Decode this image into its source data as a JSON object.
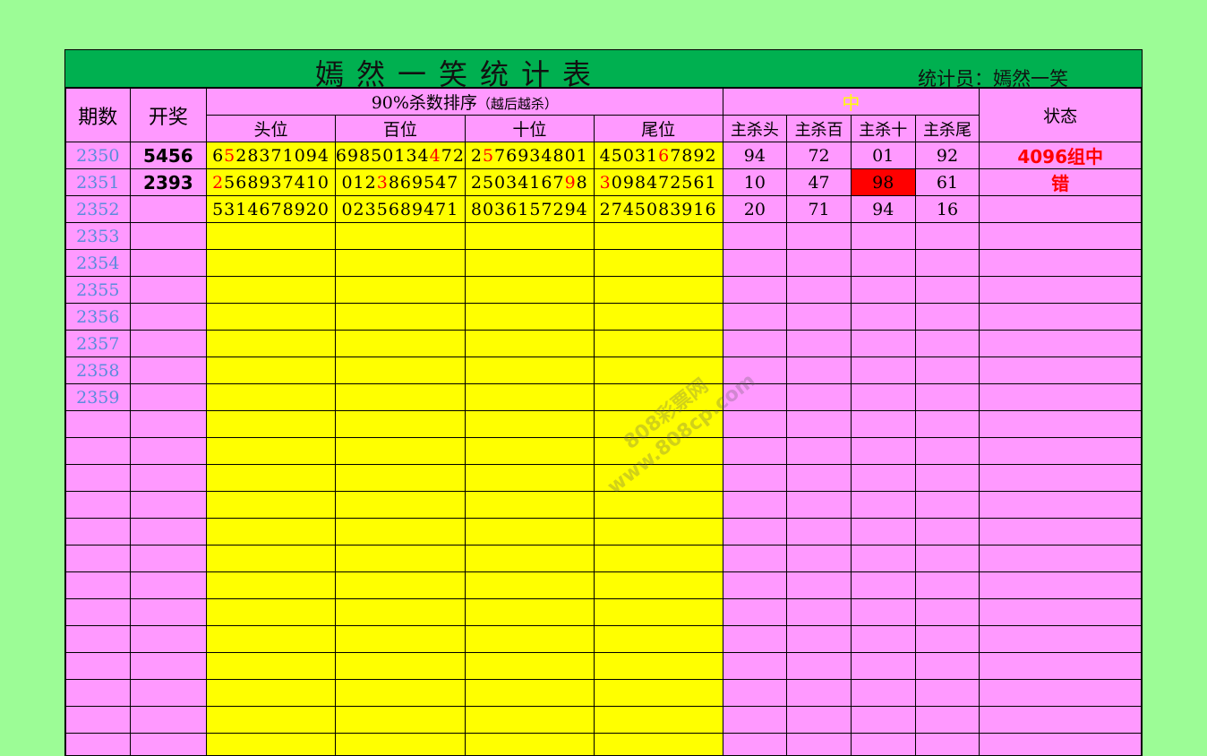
{
  "title": "嫣然一笑统计表",
  "recorder": "统计员：嫣然一笑",
  "headers": {
    "period": "期数",
    "draw": "开奖",
    "kill_group": "90%杀数排序",
    "kill_group_note": "（越后越杀）",
    "positions": [
      "头位",
      "百位",
      "十位",
      "尾位"
    ],
    "hit_group": "中",
    "main_kills": [
      "主杀头",
      "主杀百",
      "主杀十",
      "主杀尾"
    ],
    "status": "状态"
  },
  "rows": [
    {
      "period": "2350",
      "draw": "5456",
      "sequences": [
        [
          {
            "t": "6"
          },
          {
            "t": "5",
            "hl": true
          },
          {
            "t": "28371094"
          }
        ],
        [
          {
            "t": "69850134",
            "hl": false
          },
          {
            "t": "4",
            "hl": true
          },
          {
            "t": "72"
          }
        ],
        [
          {
            "t": "2"
          },
          {
            "t": "5",
            "hl": true
          },
          {
            "t": "76934801"
          }
        ],
        [
          {
            "t": "45031"
          },
          {
            "t": "6",
            "hl": true
          },
          {
            "t": "7892"
          }
        ]
      ],
      "kills": [
        "94",
        "72",
        "01",
        "92"
      ],
      "kill_hit": [
        false,
        false,
        false,
        false
      ],
      "status": "4096组中"
    },
    {
      "period": "2351",
      "draw": "2393",
      "sequences": [
        [
          {
            "t": "2",
            "hl": true
          },
          {
            "t": "568937410"
          }
        ],
        [
          {
            "t": "012"
          },
          {
            "t": "3",
            "hl": true
          },
          {
            "t": "869547"
          }
        ],
        [
          {
            "t": "25034167"
          },
          {
            "t": "9",
            "hl": true
          },
          {
            "t": "8"
          }
        ],
        [
          {
            "t": "3",
            "hl": true
          },
          {
            "t": "098472561"
          }
        ]
      ],
      "kills": [
        "10",
        "47",
        "98",
        "61"
      ],
      "kill_hit": [
        false,
        false,
        true,
        false
      ],
      "status": "错"
    },
    {
      "period": "2352",
      "draw": "",
      "sequences": [
        [
          {
            "t": "5314678920"
          }
        ],
        [
          {
            "t": "0235689471"
          }
        ],
        [
          {
            "t": "8036157294"
          }
        ],
        [
          {
            "t": "2745083916"
          }
        ]
      ],
      "kills": [
        "20",
        "71",
        "94",
        "16"
      ],
      "kill_hit": [
        false,
        false,
        false,
        false
      ],
      "status": ""
    },
    {
      "period": "2353"
    },
    {
      "period": "2354"
    },
    {
      "period": "2355"
    },
    {
      "period": "2356"
    },
    {
      "period": "2357"
    },
    {
      "period": "2358"
    },
    {
      "period": "2359"
    }
  ],
  "empty_row_count": 13,
  "watermark": [
    "808彩票网",
    "www.808cp.com"
  ],
  "colors": {
    "background": "#9cfc96",
    "title_bar": "#00b050",
    "cell_pink": "#ff99ff",
    "cell_yellow": "#ffff00",
    "highlight_red": "#ff0000",
    "period_blue": "#5b8bdc"
  }
}
